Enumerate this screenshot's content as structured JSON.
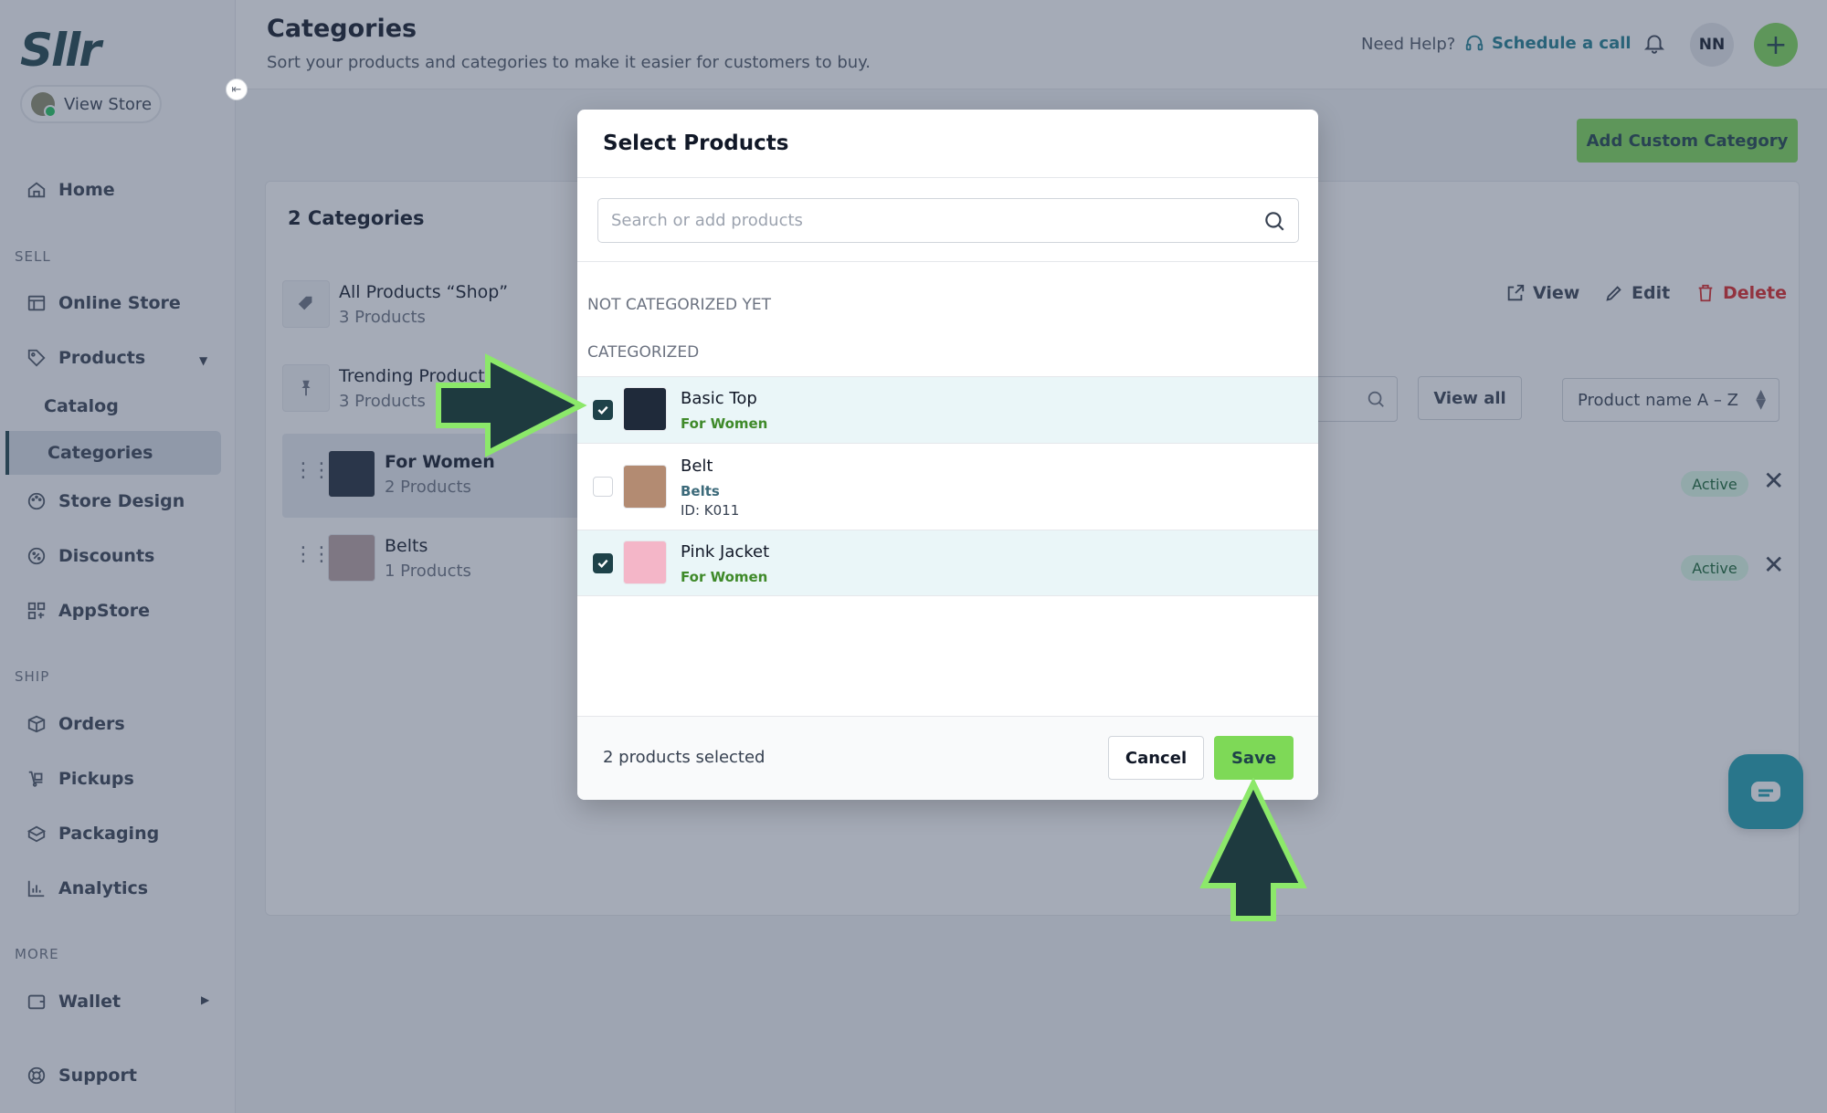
{
  "brand": {
    "logo": "Sllr"
  },
  "sidebar": {
    "view_store": "View Store",
    "home": "Home",
    "sell_label": "SELL",
    "online_store": "Online Store",
    "products": "Products",
    "catalog": "Catalog",
    "categories": "Categories",
    "store_design": "Store Design",
    "discounts": "Discounts",
    "appstore": "AppStore",
    "ship_label": "SHIP",
    "orders": "Orders",
    "pickups": "Pickups",
    "packaging": "Packaging",
    "analytics": "Analytics",
    "more_label": "MORE",
    "wallet": "Wallet",
    "support": "Support"
  },
  "header": {
    "title": "Categories",
    "subtitle": "Sort your products and categories to make it easier for customers to buy.",
    "need_help": "Need Help?",
    "schedule_call": "Schedule a call",
    "avatar_initials": "NN"
  },
  "page": {
    "add_custom_category": "Add Custom Category",
    "categories_count": "2 Categories",
    "categories": [
      {
        "name": "All Products “Shop”",
        "count": "3 Products"
      },
      {
        "name": "Trending Products",
        "count": "3 Products"
      },
      {
        "name": "For Women",
        "count": "2 Products"
      },
      {
        "name": "Belts",
        "count": "1 Products"
      }
    ],
    "actions": {
      "view": "View",
      "edit": "Edit",
      "delete": "Delete"
    },
    "view_all": "View all",
    "sort": "Product name A – Z",
    "status_badges": [
      "Active",
      "Active"
    ]
  },
  "modal": {
    "title": "Select Products",
    "search_placeholder": "Search or add products",
    "not_categorized": "NOT CATEGORIZED YET",
    "categorized": "CATEGORIZED",
    "products": [
      {
        "name": "Basic Top",
        "category": "For Women",
        "checked": true
      },
      {
        "name": "Belt",
        "category": "Belts",
        "id": "ID: K011",
        "checked": false
      },
      {
        "name": "Pink Jacket",
        "category": "For Women",
        "checked": true
      }
    ],
    "selected_count": "2 products selected",
    "cancel": "Cancel",
    "save": "Save"
  },
  "colors": {
    "accent_green": "#7ed957",
    "brand_dark": "#1e4249",
    "teal": "#1e7d8f"
  },
  "icons": [
    "home-icon",
    "store-icon",
    "tag-icon",
    "palette-icon",
    "discount-icon",
    "grid-icon",
    "box-icon",
    "pickup-icon",
    "packaging-icon",
    "chart-icon",
    "wallet-icon",
    "support-icon",
    "search-icon",
    "bell-icon",
    "headset-icon",
    "chat-icon"
  ]
}
